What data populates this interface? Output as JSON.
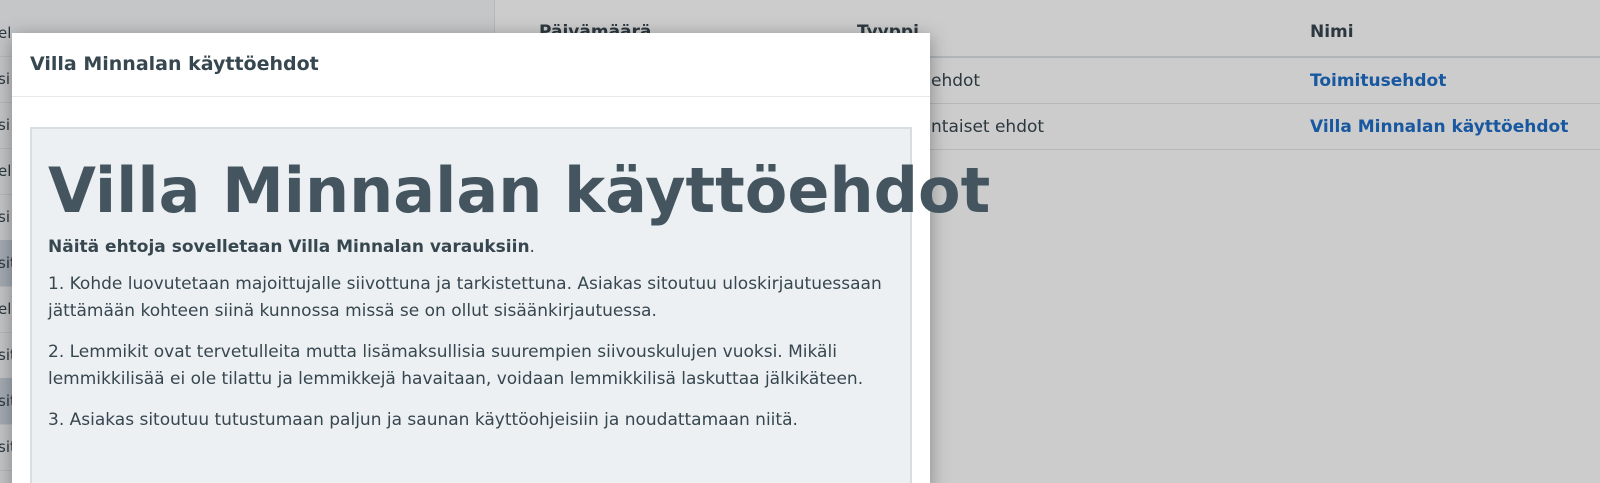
{
  "background": {
    "sidebar": {
      "items": [
        {
          "label": "el"
        },
        {
          "label": "si"
        },
        {
          "label": "si"
        },
        {
          "label": "el"
        },
        {
          "label": "si"
        },
        {
          "label": "sit"
        },
        {
          "label": "el"
        },
        {
          "label": "sit"
        },
        {
          "label": "sit"
        },
        {
          "label": "sit"
        }
      ]
    },
    "table": {
      "headers": {
        "date": "Päivämäärä",
        "type": "Tyyppi",
        "name": "Nimi"
      },
      "rows": [
        {
          "type": "ehdot",
          "name": "Toimitusehdot"
        },
        {
          "type": "ntaiset ehdot",
          "name": "Villa Minnalan käyttöehdot"
        }
      ]
    }
  },
  "modal": {
    "title": "Villa Minnalan käyttöehdot",
    "document": {
      "heading": "Villa Minnalan käyttöehdot",
      "lead_bold": "Näitä ehtoja sovelletaan Villa Minnalan varauksiin",
      "lead_end": ".",
      "paragraphs": [
        "1. Kohde luovutetaan majoittujalle siivottuna ja tarkistettuna. Asiakas sitoutuu uloskirjautuessaan jättämään kohteen siinä kunnossa missä se on ollut sisäänkirjautuessa.",
        "2. Lemmikit ovat tervetulleita mutta lisämaksullisia suurempien siivouskulujen vuoksi. Mikäli lemmikkilisää ei ole tilattu ja lemmikkejä havaitaan, voidaan lemmikkilisä laskuttaa jälkikäteen.",
        "3. Asiakas sitoutuu tutustumaan paljun ja saunan käyttöohjeisiin ja noudattamaan niitä."
      ]
    }
  },
  "colors": {
    "text": "#37474f",
    "link": "#1e6ec8",
    "content_bg": "#edf0f3"
  }
}
